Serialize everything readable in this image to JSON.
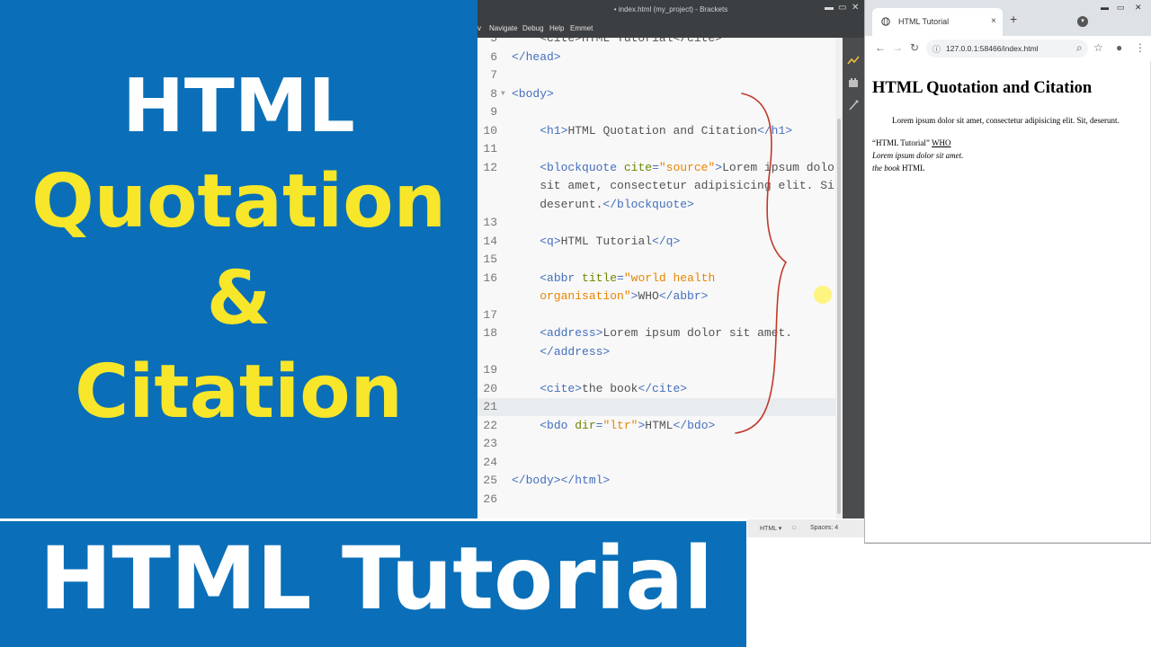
{
  "promo": {
    "line1": "HTML",
    "line2": "Quotation",
    "line3": "&",
    "line4": "Citation",
    "colors": {
      "background": "#0a6fb8",
      "white": "#ffffff",
      "yellow": "#f7e62a"
    }
  },
  "banner": {
    "text": "HTML Tutorial"
  },
  "editor": {
    "title": "• index.html (my_project) - Brackets",
    "menu": [
      "v",
      "Navigate",
      "Debug",
      "Help",
      "Emmet"
    ],
    "window_controls": {
      "minimize": "▬",
      "maximize": "▭",
      "close": "✕"
    },
    "sidebar_icons": [
      "live-preview-icon",
      "extension-manager-icon",
      "quick-edit-icon"
    ],
    "status": {
      "language": "HTML ▾",
      "spaces": "Spaces: 4"
    },
    "lines": [
      {
        "n": "5",
        "parts": [
          [
            "txt",
            "    <cite>HTML Tutorial</cite>"
          ]
        ]
      },
      {
        "n": "6",
        "parts": [
          [
            "tag",
            "</head>"
          ]
        ]
      },
      {
        "n": "7",
        "parts": []
      },
      {
        "n": "8",
        "parts": [
          [
            "tag",
            "<body>"
          ]
        ],
        "fold": "▼"
      },
      {
        "n": "9",
        "parts": []
      },
      {
        "n": "10",
        "parts": [
          [
            "sp",
            "    "
          ],
          [
            "tag",
            "<h1>"
          ],
          [
            "txt",
            "HTML Quotation and Citation"
          ],
          [
            "tag",
            "</h1>"
          ]
        ]
      },
      {
        "n": "11",
        "parts": []
      },
      {
        "n": "12",
        "parts": [
          [
            "sp",
            "    "
          ],
          [
            "tag",
            "<blockquote "
          ],
          [
            "attr",
            "cite"
          ],
          [
            "tag",
            "="
          ],
          [
            "val",
            "\"source\""
          ],
          [
            "tag",
            ">"
          ],
          [
            "txt",
            "Lorem ipsum dolor"
          ]
        ]
      },
      {
        "n": "",
        "parts": [
          [
            "txt",
            "    sit amet, consectetur adipisicing elit. Sit,"
          ]
        ]
      },
      {
        "n": "",
        "parts": [
          [
            "txt",
            "    deserunt."
          ],
          [
            "tag",
            "</blockquote>"
          ]
        ]
      },
      {
        "n": "13",
        "parts": []
      },
      {
        "n": "14",
        "parts": [
          [
            "sp",
            "    "
          ],
          [
            "tag",
            "<q>"
          ],
          [
            "txt",
            "HTML Tutorial"
          ],
          [
            "tag",
            "</q>"
          ]
        ]
      },
      {
        "n": "15",
        "parts": []
      },
      {
        "n": "16",
        "parts": [
          [
            "sp",
            "    "
          ],
          [
            "tag",
            "<abbr "
          ],
          [
            "attr",
            "title"
          ],
          [
            "tag",
            "="
          ],
          [
            "val",
            "\"world health"
          ]
        ]
      },
      {
        "n": "",
        "parts": [
          [
            "val",
            "    organisation\""
          ],
          [
            "tag",
            ">"
          ],
          [
            "txt",
            "WHO"
          ],
          [
            "tag",
            "</abbr>"
          ]
        ]
      },
      {
        "n": "17",
        "parts": []
      },
      {
        "n": "18",
        "parts": [
          [
            "sp",
            "    "
          ],
          [
            "tag",
            "<address>"
          ],
          [
            "txt",
            "Lorem ipsum dolor sit amet."
          ]
        ]
      },
      {
        "n": "",
        "parts": [
          [
            "sp",
            "    "
          ],
          [
            "tag",
            "</address>"
          ]
        ]
      },
      {
        "n": "19",
        "parts": []
      },
      {
        "n": "20",
        "parts": [
          [
            "sp",
            "    "
          ],
          [
            "tag",
            "<cite>"
          ],
          [
            "txt",
            "the book"
          ],
          [
            "tag",
            "</cite>"
          ]
        ]
      },
      {
        "n": "21",
        "parts": [],
        "active": true
      },
      {
        "n": "22",
        "parts": [
          [
            "sp",
            "    "
          ],
          [
            "tag",
            "<bdo "
          ],
          [
            "attr",
            "dir"
          ],
          [
            "tag",
            "="
          ],
          [
            "val",
            "\"ltr\""
          ],
          [
            "tag",
            ">"
          ],
          [
            "txt",
            "HTML"
          ],
          [
            "tag",
            "</bdo>"
          ]
        ]
      },
      {
        "n": "23",
        "parts": []
      },
      {
        "n": "24",
        "parts": []
      },
      {
        "n": "25",
        "parts": [
          [
            "tag",
            "</body></html>"
          ]
        ]
      },
      {
        "n": "26",
        "parts": []
      }
    ]
  },
  "browser": {
    "tab_title": "HTML Tutorial",
    "tab_icon": "globe-icon",
    "tab_close": "×",
    "new_tab": "+",
    "window_controls": {
      "minimize": "▬",
      "maximize": "▭",
      "close": "✕"
    },
    "url": "127.0.0.1:58466/index.html",
    "nav": {
      "back": "←",
      "forward": "→",
      "reload": "↻",
      "info": "ⓘ",
      "search": "⌕",
      "star": "☆",
      "profile": "●",
      "menu": "⋮"
    },
    "page": {
      "h1": "HTML Quotation and Citation",
      "blockquote": "Lorem ipsum dolor sit amet, consectetur adipisicing elit. Sit, deserunt.",
      "quote": "“HTML Tutorial”",
      "abbr": "WHO",
      "address": "Lorem ipsum dolor sit amet.",
      "cite": "the book",
      "bdo": "HTML"
    }
  }
}
